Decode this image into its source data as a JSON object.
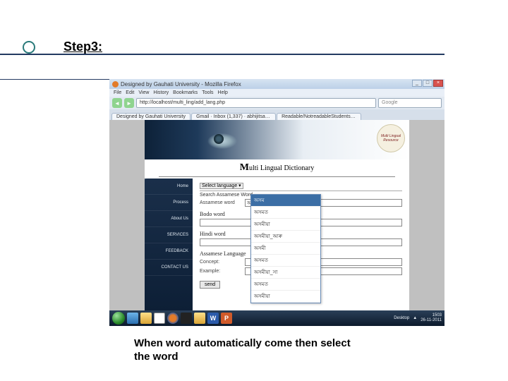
{
  "slide": {
    "title": "Step3:",
    "caption": "When word automatically come then select the word"
  },
  "browser": {
    "window_title": "Designed by Gauhati University - Mozilla Firefox",
    "menus": [
      "File",
      "Edit",
      "View",
      "History",
      "Bookmarks",
      "Tools",
      "Help"
    ],
    "url": "http://localhost/multi_ling/add_lang.php",
    "search_placeholder": "Google",
    "tabs": [
      "Designed by Gauhati University",
      "Gmail · Inbox (1,337) · abhijitsarmah...",
      "Readable/NotreadableStudentsonof W..."
    ],
    "win_min": "_",
    "win_max": "□",
    "win_close": "×",
    "back": "◄",
    "fwd": "►"
  },
  "page": {
    "badge_text": "Multi Lingual Resource",
    "dict_title_prefix": "M",
    "dict_title_rest": "ulti Lingual Dictionary",
    "sidebar": [
      "Home",
      "Process",
      "About Us",
      "SERVICES",
      "FEEDBACK",
      "CONTACT US"
    ],
    "lang_select": "Select language ▾",
    "fieldset": "Search Assamese Word",
    "assamese_label": "Assamese word",
    "assamese_value": "অসম|",
    "bodo_head": "Bodo word",
    "hindi_head": "Hindi word",
    "assam_lang_head": "Assamese Language",
    "concept_label": "Concept:",
    "example_label": "Example:",
    "submit": "send",
    "autocomplete": [
      "অসম",
      "অসমত",
      "অসমীয়া",
      "অসমীয়া_আৰু",
      "অসমী",
      "অসমত",
      "অসমীয়া_সা",
      "অসমত",
      "অসমীয়া"
    ]
  },
  "taskbar": {
    "desktop_label": "Desktop",
    "time": "1503",
    "date": "26-11-2011",
    "w": "W",
    "p": "P"
  }
}
